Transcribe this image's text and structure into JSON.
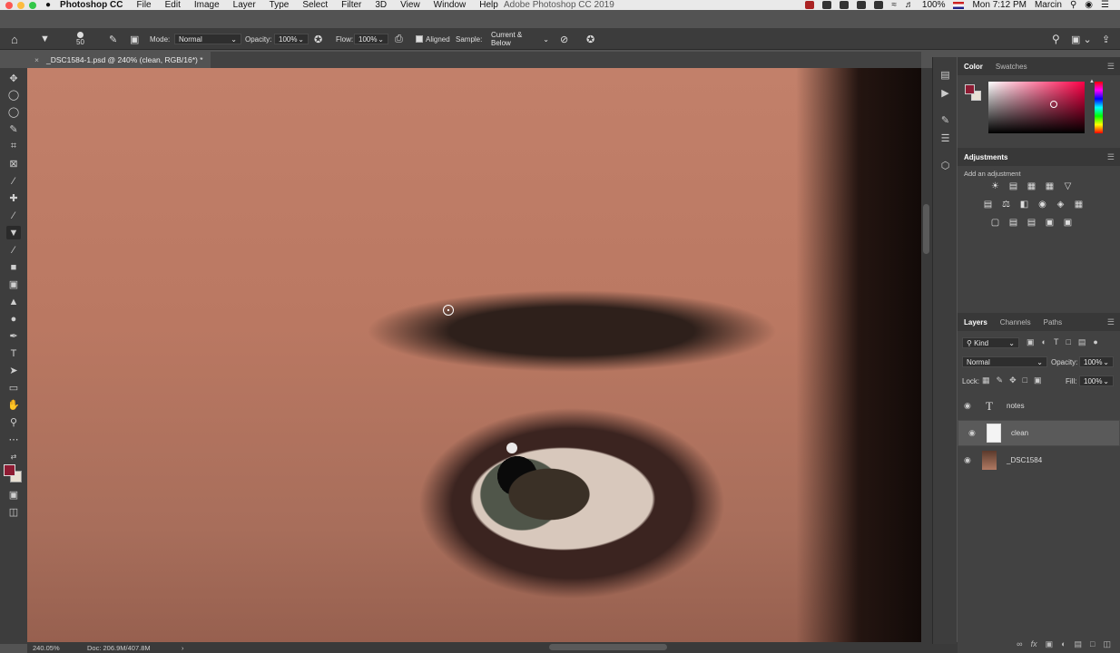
{
  "menubar": {
    "app_name": "Photoshop CC",
    "menus": [
      "File",
      "Edit",
      "Image",
      "Layer",
      "Type",
      "Select",
      "Filter",
      "3D",
      "View",
      "Window",
      "Help"
    ],
    "window_title": "Adobe Photoshop CC 2019",
    "battery": "100%",
    "clock": "Mon 7:12 PM",
    "user": "Marcin"
  },
  "options": {
    "brush_size": "50",
    "mode_label": "Mode:",
    "mode_value": "Normal",
    "opacity_label": "Opacity:",
    "opacity_value": "100%",
    "flow_label": "Flow:",
    "flow_value": "100%",
    "aligned_label": "Aligned",
    "sample_label": "Sample:",
    "sample_value": "Current & Below"
  },
  "document": {
    "tab_title": "_DSC1584-1.psd @ 240% (clean, RGB/16*) *",
    "zoom": "240.05%",
    "doc_size": "Doc: 206.9M/407.8M"
  },
  "color_panel": {
    "tabs": [
      "Color",
      "Swatches"
    ],
    "foreground": "#8e1b33",
    "background": "#e8e0d4"
  },
  "adjustments_panel": {
    "title": "Adjustments",
    "hint": "Add an adjustment"
  },
  "layers_panel": {
    "tabs": [
      "Layers",
      "Channels",
      "Paths"
    ],
    "filter_kind": "Kind",
    "blend_mode": "Normal",
    "opacity_label": "Opacity:",
    "opacity_value": "100%",
    "lock_label": "Lock:",
    "fill_label": "Fill:",
    "fill_value": "100%",
    "layers": [
      {
        "name": "notes",
        "type": "text"
      },
      {
        "name": "clean",
        "type": "pixel",
        "selected": true
      },
      {
        "name": "_DSC1584",
        "type": "image"
      }
    ]
  },
  "icons": {
    "traffic_colors": [
      "#fc5753",
      "#fdbc40",
      "#33c748"
    ],
    "accent": "#8e1b33"
  }
}
